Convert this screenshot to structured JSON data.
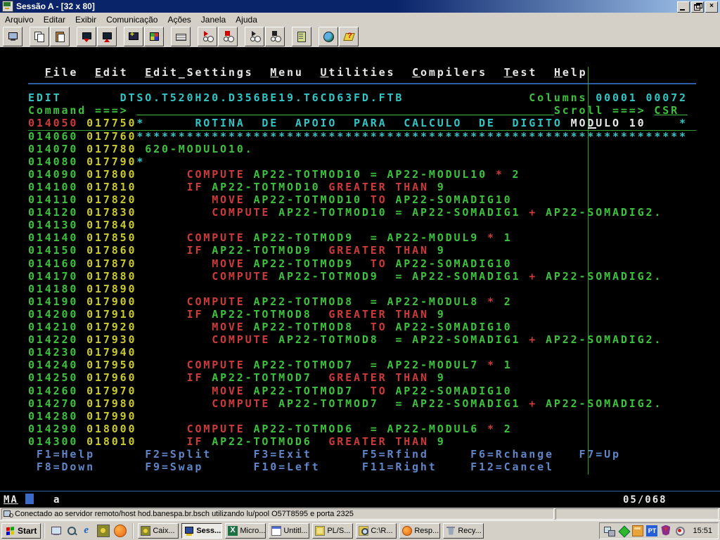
{
  "window": {
    "title": "Sessão A - [32 x 80]"
  },
  "menubar": {
    "items": [
      {
        "label": "Arquivo",
        "name": "arquivo"
      },
      {
        "label": "Editar",
        "name": "editar"
      },
      {
        "label": "Exibir",
        "name": "exibir"
      },
      {
        "label": "Comunicação",
        "name": "comunicacao"
      },
      {
        "label": "Ações",
        "name": "acoes"
      },
      {
        "label": "Janela",
        "name": "janela"
      },
      {
        "label": "Ajuda",
        "name": "ajuda"
      }
    ]
  },
  "toolbar": {
    "groups": [
      [
        "new-session"
      ],
      [
        "copy",
        "paste"
      ],
      [
        "send-file",
        "receive-file"
      ],
      [
        "display-setup",
        "color-setup"
      ],
      [
        "keyboard-setup"
      ],
      [
        "record-macro",
        "stop-record"
      ],
      [
        "play-macro",
        "quit-macro"
      ],
      [
        "scratchpad"
      ],
      [
        "web",
        "help"
      ]
    ]
  },
  "terminal": {
    "palette": {
      "g": "#3cc23c",
      "y": "#c9c931",
      "r": "#cd3a3a",
      "c": "#30c6c6",
      "w": "#e8e8e8",
      "b": "#5e86c9"
    },
    "oia": {
      "left": "MA",
      "mid": "a",
      "pos": "05/068"
    },
    "rows": [
      {
        "r": 1,
        "s": [
          [
            "w",
            "  "
          ],
          [
            "w",
            "F",
            1
          ],
          [
            "w",
            "ile  "
          ],
          [
            "w",
            "E",
            1
          ],
          [
            "w",
            "dit  "
          ],
          [
            "w",
            "E",
            1
          ],
          [
            "w",
            "dit_Settings  "
          ],
          [
            "w",
            "M",
            1
          ],
          [
            "w",
            "enu  "
          ],
          [
            "w",
            "U",
            1
          ],
          [
            "w",
            "tilities  "
          ],
          [
            "w",
            "C",
            1
          ],
          [
            "w",
            "ompilers  "
          ],
          [
            "w",
            "T",
            1
          ],
          [
            "w",
            "est  "
          ],
          [
            "w",
            "H",
            1
          ],
          [
            "w",
            "elp"
          ]
        ]
      },
      {
        "r": 3,
        "s": [
          [
            "c",
            "EDIT       DTSO.T520H20.D356BE19.T6CD63FD.FTB"
          ],
          [
            "g",
            "               Columns"
          ],
          [
            "c",
            " 00001 00072"
          ]
        ]
      },
      {
        "r": 4,
        "s": [
          [
            "g",
            "Command ===> "
          ],
          [
            "g",
            "                                                  ",
            1
          ],
          [
            "g",
            "Scroll ===> "
          ],
          [
            "g",
            "CSR ",
            1
          ]
        ]
      },
      {
        "r": 5,
        "s": [
          [
            "r",
            "014050"
          ],
          [
            "y",
            " 017750"
          ],
          [
            "c",
            "*      ROTINA  DE  APOIO  PARA  CALCULO  DE  DIGITO "
          ],
          [
            "w",
            "MODULO 10"
          ],
          [
            "c",
            "    *"
          ]
        ]
      },
      {
        "r": 6,
        "s": [
          [
            "g",
            "014060"
          ],
          [
            "y",
            " 017760"
          ],
          [
            "c",
            "******************************************************************"
          ]
        ]
      },
      {
        "r": 7,
        "s": [
          [
            "g",
            "014070"
          ],
          [
            "y",
            " 017780"
          ],
          [
            "g",
            " 620-MODULO10."
          ]
        ]
      },
      {
        "r": 8,
        "s": [
          [
            "g",
            "014080"
          ],
          [
            "y",
            " 017790"
          ],
          [
            "c",
            "*"
          ]
        ]
      },
      {
        "r": 9,
        "s": [
          [
            "g",
            "014090"
          ],
          [
            "y",
            " 017800"
          ],
          [
            "w",
            "      "
          ],
          [
            "r",
            "COMPUTE"
          ],
          [
            "g",
            " AP22-TOTMOD10 = AP22-MODUL10 "
          ],
          [
            "r",
            "*"
          ],
          [
            "g",
            " 2"
          ]
        ]
      },
      {
        "r": 10,
        "s": [
          [
            "g",
            "014100"
          ],
          [
            "y",
            " 017810"
          ],
          [
            "w",
            "      "
          ],
          [
            "r",
            "IF"
          ],
          [
            "g",
            " AP22-TOTMOD10 "
          ],
          [
            "r",
            "GREATER THAN"
          ],
          [
            "g",
            " 9"
          ]
        ]
      },
      {
        "r": 11,
        "s": [
          [
            "g",
            "014110"
          ],
          [
            "y",
            " 017820"
          ],
          [
            "w",
            "         "
          ],
          [
            "r",
            "MOVE"
          ],
          [
            "g",
            " AP22-TOTMOD10 "
          ],
          [
            "r",
            "TO"
          ],
          [
            "g",
            " AP22-SOMADIG10"
          ]
        ]
      },
      {
        "r": 12,
        "s": [
          [
            "g",
            "014120"
          ],
          [
            "y",
            " 017830"
          ],
          [
            "w",
            "         "
          ],
          [
            "r",
            "COMPUTE"
          ],
          [
            "g",
            " AP22-TOTMOD10 = AP22-SOMADIG1 "
          ],
          [
            "r",
            "+"
          ],
          [
            "g",
            " AP22-SOMADIG2."
          ]
        ]
      },
      {
        "r": 13,
        "s": [
          [
            "g",
            "014130"
          ],
          [
            "y",
            " 017840"
          ]
        ]
      },
      {
        "r": 14,
        "s": [
          [
            "g",
            "014140"
          ],
          [
            "y",
            " 017850"
          ],
          [
            "w",
            "      "
          ],
          [
            "r",
            "COMPUTE"
          ],
          [
            "g",
            " AP22-TOTMOD9  = AP22-MODUL9 "
          ],
          [
            "r",
            "*"
          ],
          [
            "g",
            " 1"
          ]
        ]
      },
      {
        "r": 15,
        "s": [
          [
            "g",
            "014150"
          ],
          [
            "y",
            " 017860"
          ],
          [
            "w",
            "      "
          ],
          [
            "r",
            "IF"
          ],
          [
            "g",
            " AP22-TOTMOD9  "
          ],
          [
            "r",
            "GREATER THAN"
          ],
          [
            "g",
            " 9"
          ]
        ]
      },
      {
        "r": 16,
        "s": [
          [
            "g",
            "014160"
          ],
          [
            "y",
            " 017870"
          ],
          [
            "w",
            "         "
          ],
          [
            "r",
            "MOVE"
          ],
          [
            "g",
            " AP22-TOTMOD9  "
          ],
          [
            "r",
            "TO"
          ],
          [
            "g",
            " AP22-SOMADIG10"
          ]
        ]
      },
      {
        "r": 17,
        "s": [
          [
            "g",
            "014170"
          ],
          [
            "y",
            " 017880"
          ],
          [
            "w",
            "         "
          ],
          [
            "r",
            "COMPUTE"
          ],
          [
            "g",
            " AP22-TOTMOD9  = AP22-SOMADIG1 "
          ],
          [
            "r",
            "+"
          ],
          [
            "g",
            " AP22-SOMADIG2."
          ]
        ]
      },
      {
        "r": 18,
        "s": [
          [
            "g",
            "014180"
          ],
          [
            "y",
            " 017890"
          ]
        ]
      },
      {
        "r": 19,
        "s": [
          [
            "g",
            "014190"
          ],
          [
            "y",
            " 017900"
          ],
          [
            "w",
            "      "
          ],
          [
            "r",
            "COMPUTE"
          ],
          [
            "g",
            " AP22-TOTMOD8  = AP22-MODUL8 "
          ],
          [
            "r",
            "*"
          ],
          [
            "g",
            " 2"
          ]
        ]
      },
      {
        "r": 20,
        "s": [
          [
            "g",
            "014200"
          ],
          [
            "y",
            " 017910"
          ],
          [
            "w",
            "      "
          ],
          [
            "r",
            "IF"
          ],
          [
            "g",
            " AP22-TOTMOD8  "
          ],
          [
            "r",
            "GREATER THAN"
          ],
          [
            "g",
            " 9"
          ]
        ]
      },
      {
        "r": 21,
        "s": [
          [
            "g",
            "014210"
          ],
          [
            "y",
            " 017920"
          ],
          [
            "w",
            "         "
          ],
          [
            "r",
            "MOVE"
          ],
          [
            "g",
            " AP22-TOTMOD8  "
          ],
          [
            "r",
            "TO"
          ],
          [
            "g",
            " AP22-SOMADIG10"
          ]
        ]
      },
      {
        "r": 22,
        "s": [
          [
            "g",
            "014220"
          ],
          [
            "y",
            " 017930"
          ],
          [
            "w",
            "         "
          ],
          [
            "r",
            "COMPUTE"
          ],
          [
            "g",
            " AP22-TOTMOD8  = AP22-SOMADIG1 "
          ],
          [
            "r",
            "+"
          ],
          [
            "g",
            " AP22-SOMADIG2."
          ]
        ]
      },
      {
        "r": 23,
        "s": [
          [
            "g",
            "014230"
          ],
          [
            "y",
            " 017940"
          ]
        ]
      },
      {
        "r": 24,
        "s": [
          [
            "g",
            "014240"
          ],
          [
            "y",
            " 017950"
          ],
          [
            "w",
            "      "
          ],
          [
            "r",
            "COMPUTE"
          ],
          [
            "g",
            " AP22-TOTMOD7  = AP22-MODUL7 "
          ],
          [
            "r",
            "*"
          ],
          [
            "g",
            " 1"
          ]
        ]
      },
      {
        "r": 25,
        "s": [
          [
            "g",
            "014250"
          ],
          [
            "y",
            " 017960"
          ],
          [
            "w",
            "      "
          ],
          [
            "r",
            "IF"
          ],
          [
            "g",
            " AP22-TOTMOD7  "
          ],
          [
            "r",
            "GREATER THAN"
          ],
          [
            "g",
            " 9"
          ]
        ]
      },
      {
        "r": 26,
        "s": [
          [
            "g",
            "014260"
          ],
          [
            "y",
            " 017970"
          ],
          [
            "w",
            "         "
          ],
          [
            "r",
            "MOVE"
          ],
          [
            "g",
            " AP22-TOTMOD7  "
          ],
          [
            "r",
            "TO"
          ],
          [
            "g",
            " AP22-SOMADIG10"
          ]
        ]
      },
      {
        "r": 27,
        "s": [
          [
            "g",
            "014270"
          ],
          [
            "y",
            " 017980"
          ],
          [
            "w",
            "         "
          ],
          [
            "r",
            "COMPUTE"
          ],
          [
            "g",
            " AP22-TOTMOD7  = AP22-SOMADIG1 "
          ],
          [
            "r",
            "+"
          ],
          [
            "g",
            " AP22-SOMADIG2."
          ]
        ]
      },
      {
        "r": 28,
        "s": [
          [
            "g",
            "014280"
          ],
          [
            "y",
            " 017990"
          ]
        ]
      },
      {
        "r": 29,
        "s": [
          [
            "g",
            "014290"
          ],
          [
            "y",
            " 018000"
          ],
          [
            "w",
            "      "
          ],
          [
            "r",
            "COMPUTE"
          ],
          [
            "g",
            " AP22-TOTMOD6  = AP22-MODUL6 "
          ],
          [
            "r",
            "*"
          ],
          [
            "g",
            " 2"
          ]
        ]
      },
      {
        "r": 30,
        "s": [
          [
            "g",
            "014300"
          ],
          [
            "y",
            " 018010"
          ],
          [
            "w",
            "      "
          ],
          [
            "r",
            "IF"
          ],
          [
            "g",
            " AP22-TOTMOD6  "
          ],
          [
            "r",
            "GREATER THAN"
          ],
          [
            "g",
            " 9"
          ]
        ]
      },
      {
        "r": 31,
        "s": [
          [
            "b",
            " F1=Help      F2=Split     F3=Exit      F5=Rfind     F6=Rchange   F7=Up"
          ]
        ]
      },
      {
        "r": 32,
        "s": [
          [
            "b",
            " F8=Down      F9=Swap      F10=Left     F11=Right    F12=Cancel"
          ]
        ]
      }
    ]
  },
  "statusbar": {
    "text": "Conectado ao servidor remoto/host hod.banespa.br.bsch utilizando lu/pool O57T8595 e porta 2325"
  },
  "taskbar": {
    "start_label": "Start",
    "quicklaunch": [
      "show-desktop",
      "search",
      "ie",
      "pcomm",
      "firefox"
    ],
    "tasks": [
      {
        "label": "Caix...",
        "icon": "caixa",
        "active": false
      },
      {
        "label": "Sess...",
        "icon": "session",
        "active": true
      },
      {
        "label": "Micro...",
        "icon": "excel",
        "active": false
      },
      {
        "label": "Untitl...",
        "icon": "notepad",
        "active": false
      },
      {
        "label": "PL/S...",
        "icon": "plsql",
        "active": false
      },
      {
        "label": "C:\\R...",
        "icon": "search",
        "active": false
      },
      {
        "label": "Resp...",
        "icon": "firefox",
        "active": false
      },
      {
        "label": "Recy...",
        "icon": "recycle",
        "active": false
      }
    ],
    "tray": {
      "icons": [
        "network-pc",
        "green-diamond",
        "orange-window",
        "lang",
        "shield",
        "magnifier"
      ],
      "lang": "PT",
      "time": "15:51"
    }
  }
}
